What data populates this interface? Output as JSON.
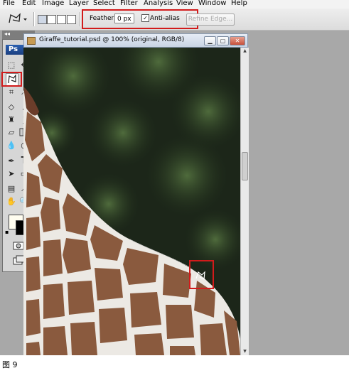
{
  "menu": [
    "File",
    "Edit",
    "Image",
    "Layer",
    "Select",
    "Filter",
    "Analysis",
    "View",
    "Window",
    "Help"
  ],
  "options_bar": {
    "feather_label": "Feather:",
    "feather_value": "0 px",
    "anti_alias_label": "Anti-alias",
    "anti_alias_checked": true,
    "refine_edge_label": "Refine Edge..."
  },
  "tools_panel": {
    "collapse_glyph": "◂◂",
    "logo": "Ps",
    "active_tool": "polygonal-lasso-tool"
  },
  "document": {
    "title": "Giraffe_tutorial.psd @ 100% (original, RGB/8)"
  },
  "caption": "图 9",
  "colors": {
    "highlight": "#d21b1b",
    "foreground_swatch": "#fffdf0",
    "background_swatch": "#000000"
  }
}
